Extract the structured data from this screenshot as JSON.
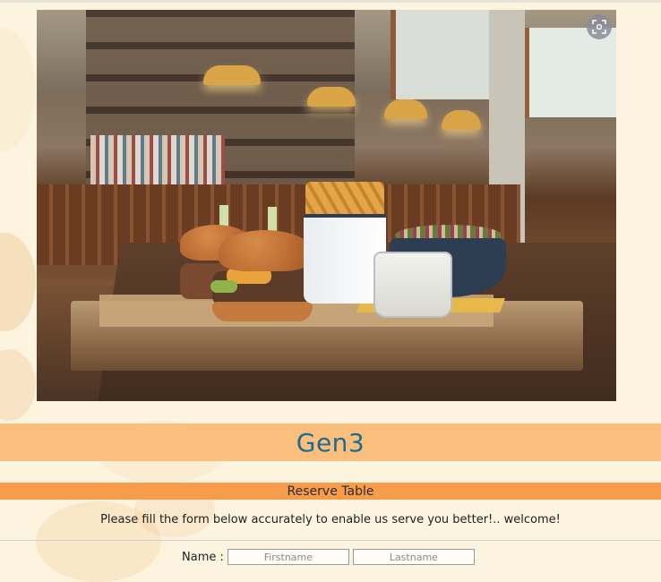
{
  "hero": {
    "image_alt": "Burgers, fries and sides on a wooden board in a restaurant",
    "scan_icon": "scan-icon"
  },
  "brand": {
    "name": "Gen3",
    "color": "#1f6a8f",
    "bar_color": "#fbbf7d"
  },
  "reserve": {
    "title": "Reserve Table",
    "bar_color": "#f79c4a"
  },
  "form": {
    "intro": "Please fill the form below accurately to enable us serve you better!.. welcome!",
    "name_label": "Name :",
    "firstname_placeholder": "Firstname",
    "lastname_placeholder": "Lastname"
  }
}
